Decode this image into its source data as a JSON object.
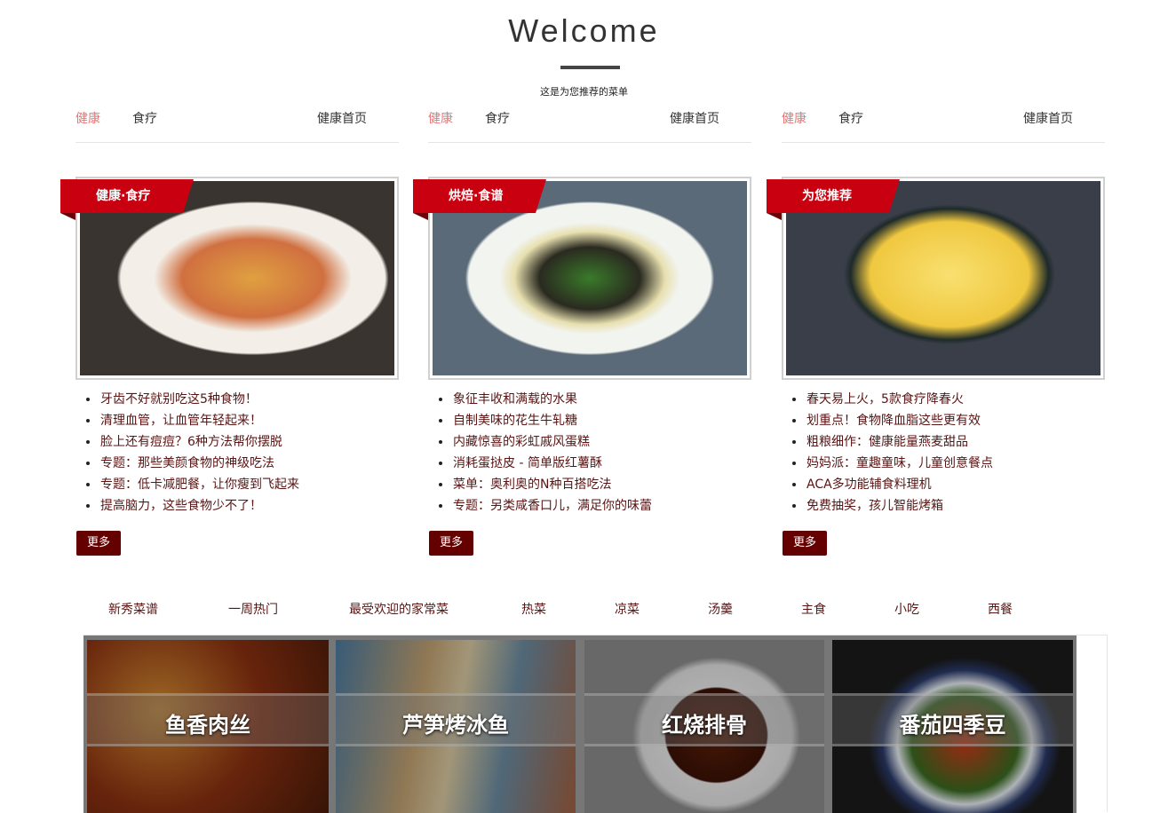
{
  "header": {
    "title": "Welcome",
    "subtitle": "这是为您推荐的菜单"
  },
  "columns": [
    {
      "tab_active": "健康",
      "tab_second": "食疗",
      "tab_home": "健康首页",
      "ribbon": "健康·食疗",
      "items": [
        "牙齿不好就别吃这5种食物！",
        "清理血管，让血管年轻起来！",
        "脸上还有痘痘？6种方法帮你摆脱",
        "专题：那些美颜食物的神级吃法",
        "专题：低卡减肥餐，让你瘦到飞起来",
        "提高脑力，这些食物少不了！"
      ],
      "more": "更多"
    },
    {
      "tab_active": "健康",
      "tab_second": "食疗",
      "tab_home": "健康首页",
      "ribbon": "烘焙·食谱",
      "items": [
        "象征丰收和满载的水果",
        "自制美味的花生牛轧糖",
        "内藏惊喜的彩虹戚风蛋糕",
        "消耗蛋挞皮 - 简单版红薯酥",
        "菜单：奥利奥的N种百搭吃法",
        "专题：另类咸香口儿，满足你的味蕾"
      ],
      "more": "更多"
    },
    {
      "tab_active": "健康",
      "tab_second": "食疗",
      "tab_home": "健康首页",
      "ribbon": "为您推荐",
      "items": [
        "春天易上火，5款食疗降春火",
        "划重点！食物降血脂这些更有效",
        "粗粮细作：健康能量燕麦甜品",
        "妈妈派：童趣童味，儿童创意餐点",
        "ACA多功能辅食料理机",
        "免费抽奖，孩儿智能烤箱"
      ],
      "more": "更多"
    }
  ],
  "categories": [
    "新秀菜谱",
    "一周热门",
    "最受欢迎的家常菜",
    "热菜",
    "凉菜",
    "汤羹",
    "主食",
    "小吃",
    "西餐"
  ],
  "dishes": [
    "鱼香肉丝",
    "芦笋烤冰鱼",
    "红烧排骨",
    "番茄四季豆"
  ],
  "colors": {
    "ribbon": "#c9000f",
    "more_button": "#650000",
    "tab_active": "#f07070",
    "link": "#5a1414"
  }
}
